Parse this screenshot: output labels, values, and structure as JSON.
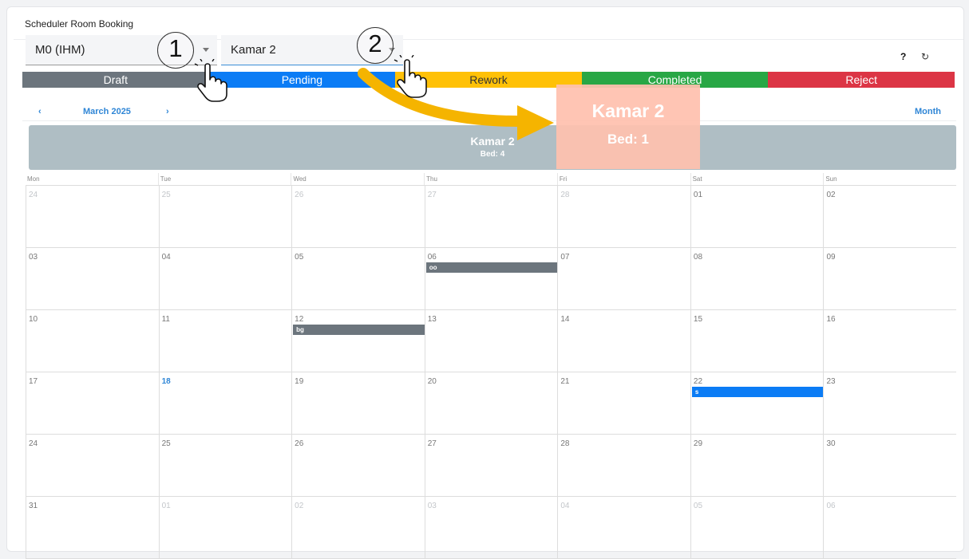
{
  "card": {
    "title": "Scheduler Room Booking"
  },
  "filters": {
    "unit": {
      "value": "M0 (IHM)"
    },
    "room": {
      "value": "Kamar 2"
    }
  },
  "toolbar": {
    "help_icon": "❓",
    "refresh_icon": "⟳"
  },
  "statuses": [
    {
      "label": "Draft",
      "color": "#6c757d"
    },
    {
      "label": "Pending",
      "color": "#0b7cf5"
    },
    {
      "label": "Rework",
      "color": "#ffc107"
    },
    {
      "label": "Completed",
      "color": "#28a745"
    },
    {
      "label": "Reject",
      "color": "#dc3545"
    }
  ],
  "calendar_nav": {
    "prev": "‹",
    "month": "March 2025",
    "next": "›",
    "view": "Month"
  },
  "resource": {
    "name": "Kamar 2",
    "bed": "Bed: 4"
  },
  "weekdays": [
    "Mon",
    "Tue",
    "Wed",
    "Thu",
    "Fri",
    "Sat",
    "Sun"
  ],
  "weeks": [
    [
      {
        "d": "24",
        "o": true
      },
      {
        "d": "25",
        "o": true
      },
      {
        "d": "26",
        "o": true
      },
      {
        "d": "27",
        "o": true
      },
      {
        "d": "28",
        "o": true
      },
      {
        "d": "01"
      },
      {
        "d": "02"
      }
    ],
    [
      {
        "d": "03"
      },
      {
        "d": "04"
      },
      {
        "d": "05"
      },
      {
        "d": "06",
        "event": "oo",
        "status": "draft"
      },
      {
        "d": "07"
      },
      {
        "d": "08"
      },
      {
        "d": "09"
      }
    ],
    [
      {
        "d": "10"
      },
      {
        "d": "11"
      },
      {
        "d": "12",
        "event": "bg",
        "status": "draft"
      },
      {
        "d": "13"
      },
      {
        "d": "14"
      },
      {
        "d": "15"
      },
      {
        "d": "16"
      }
    ],
    [
      {
        "d": "17"
      },
      {
        "d": "18",
        "today": true
      },
      {
        "d": "19"
      },
      {
        "d": "20"
      },
      {
        "d": "21"
      },
      {
        "d": "22",
        "event": "s",
        "status": "pending"
      },
      {
        "d": "23"
      }
    ],
    [
      {
        "d": "24"
      },
      {
        "d": "25"
      },
      {
        "d": "26"
      },
      {
        "d": "27"
      },
      {
        "d": "28"
      },
      {
        "d": "29"
      },
      {
        "d": "30"
      }
    ],
    [
      {
        "d": "31"
      },
      {
        "d": "01",
        "o": true
      },
      {
        "d": "02",
        "o": true
      },
      {
        "d": "03",
        "o": true
      },
      {
        "d": "04",
        "o": true
      },
      {
        "d": "05",
        "o": true
      },
      {
        "d": "06",
        "o": true
      }
    ]
  ],
  "annotations": {
    "step1": "1",
    "step2": "2",
    "tooltip_title": "Kamar 2",
    "tooltip_bed": "Bed: 1",
    "arrow_color": "#f5b400"
  }
}
